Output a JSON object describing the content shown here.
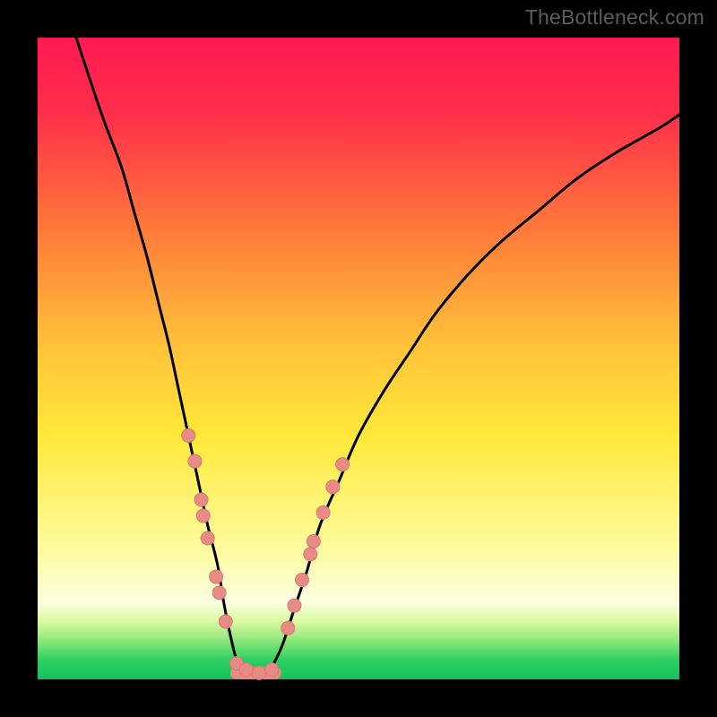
{
  "watermark": "TheBottleneck.com",
  "colors": {
    "frame": "#000000",
    "curve": "#000000",
    "dot_fill": "#e98b85",
    "dot_stroke": "#d87a74",
    "watermark": "#5c5c5c",
    "gradient_stops": [
      {
        "pct": 0,
        "color": "#ff1a53"
      },
      {
        "pct": 12,
        "color": "#ff2f4a"
      },
      {
        "pct": 30,
        "color": "#ff7a3a"
      },
      {
        "pct": 48,
        "color": "#ffc23a"
      },
      {
        "pct": 62,
        "color": "#ffe93a"
      },
      {
        "pct": 80,
        "color": "#fdfca0"
      },
      {
        "pct": 88,
        "color": "#fbfee0"
      },
      {
        "pct": 91,
        "color": "#d9f9a0"
      },
      {
        "pct": 94,
        "color": "#8de77a"
      },
      {
        "pct": 97,
        "color": "#2dcf63"
      },
      {
        "pct": 100,
        "color": "#17c05c"
      }
    ]
  },
  "chart_data": {
    "type": "line",
    "title": "",
    "xlabel": "",
    "ylabel": "",
    "xlim": [
      0,
      100
    ],
    "ylim": [
      0,
      100
    ],
    "series": [
      {
        "name": "left-curve",
        "x": [
          6,
          10,
          13,
          15,
          17,
          19,
          20.5,
          22,
          23.5,
          25,
          26.5,
          28,
          29,
          30,
          31,
          32
        ],
        "values": [
          100,
          88,
          80,
          73,
          66,
          58,
          52,
          45,
          38,
          31,
          24,
          18,
          12,
          7,
          3,
          1
        ]
      },
      {
        "name": "right-curve",
        "x": [
          36,
          38,
          40,
          42,
          44,
          47,
          50,
          54,
          58,
          62,
          67,
          72,
          78,
          84,
          90,
          97,
          100
        ],
        "values": [
          1,
          5,
          11,
          17,
          24,
          31,
          38,
          45,
          51,
          57,
          63,
          68,
          73,
          78,
          82,
          86,
          88
        ]
      }
    ],
    "flat_segment": {
      "x_start": 31,
      "x_end": 37,
      "y": 1
    },
    "dots": [
      {
        "x": 23.5,
        "y": 38
      },
      {
        "x": 24.5,
        "y": 34
      },
      {
        "x": 25.5,
        "y": 28
      },
      {
        "x": 25.8,
        "y": 25.5
      },
      {
        "x": 26.5,
        "y": 22
      },
      {
        "x": 27.8,
        "y": 16
      },
      {
        "x": 28.3,
        "y": 13.5
      },
      {
        "x": 29.3,
        "y": 9
      },
      {
        "x": 31.0,
        "y": 2.5
      },
      {
        "x": 32.5,
        "y": 1.5
      },
      {
        "x": 34.5,
        "y": 1
      },
      {
        "x": 36.5,
        "y": 1.5
      },
      {
        "x": 39.0,
        "y": 8
      },
      {
        "x": 40.0,
        "y": 11.5
      },
      {
        "x": 41.2,
        "y": 15.5
      },
      {
        "x": 42.5,
        "y": 19.5
      },
      {
        "x": 43.0,
        "y": 21.5
      },
      {
        "x": 44.5,
        "y": 26
      },
      {
        "x": 46.0,
        "y": 30
      },
      {
        "x": 47.5,
        "y": 33.5
      }
    ]
  }
}
